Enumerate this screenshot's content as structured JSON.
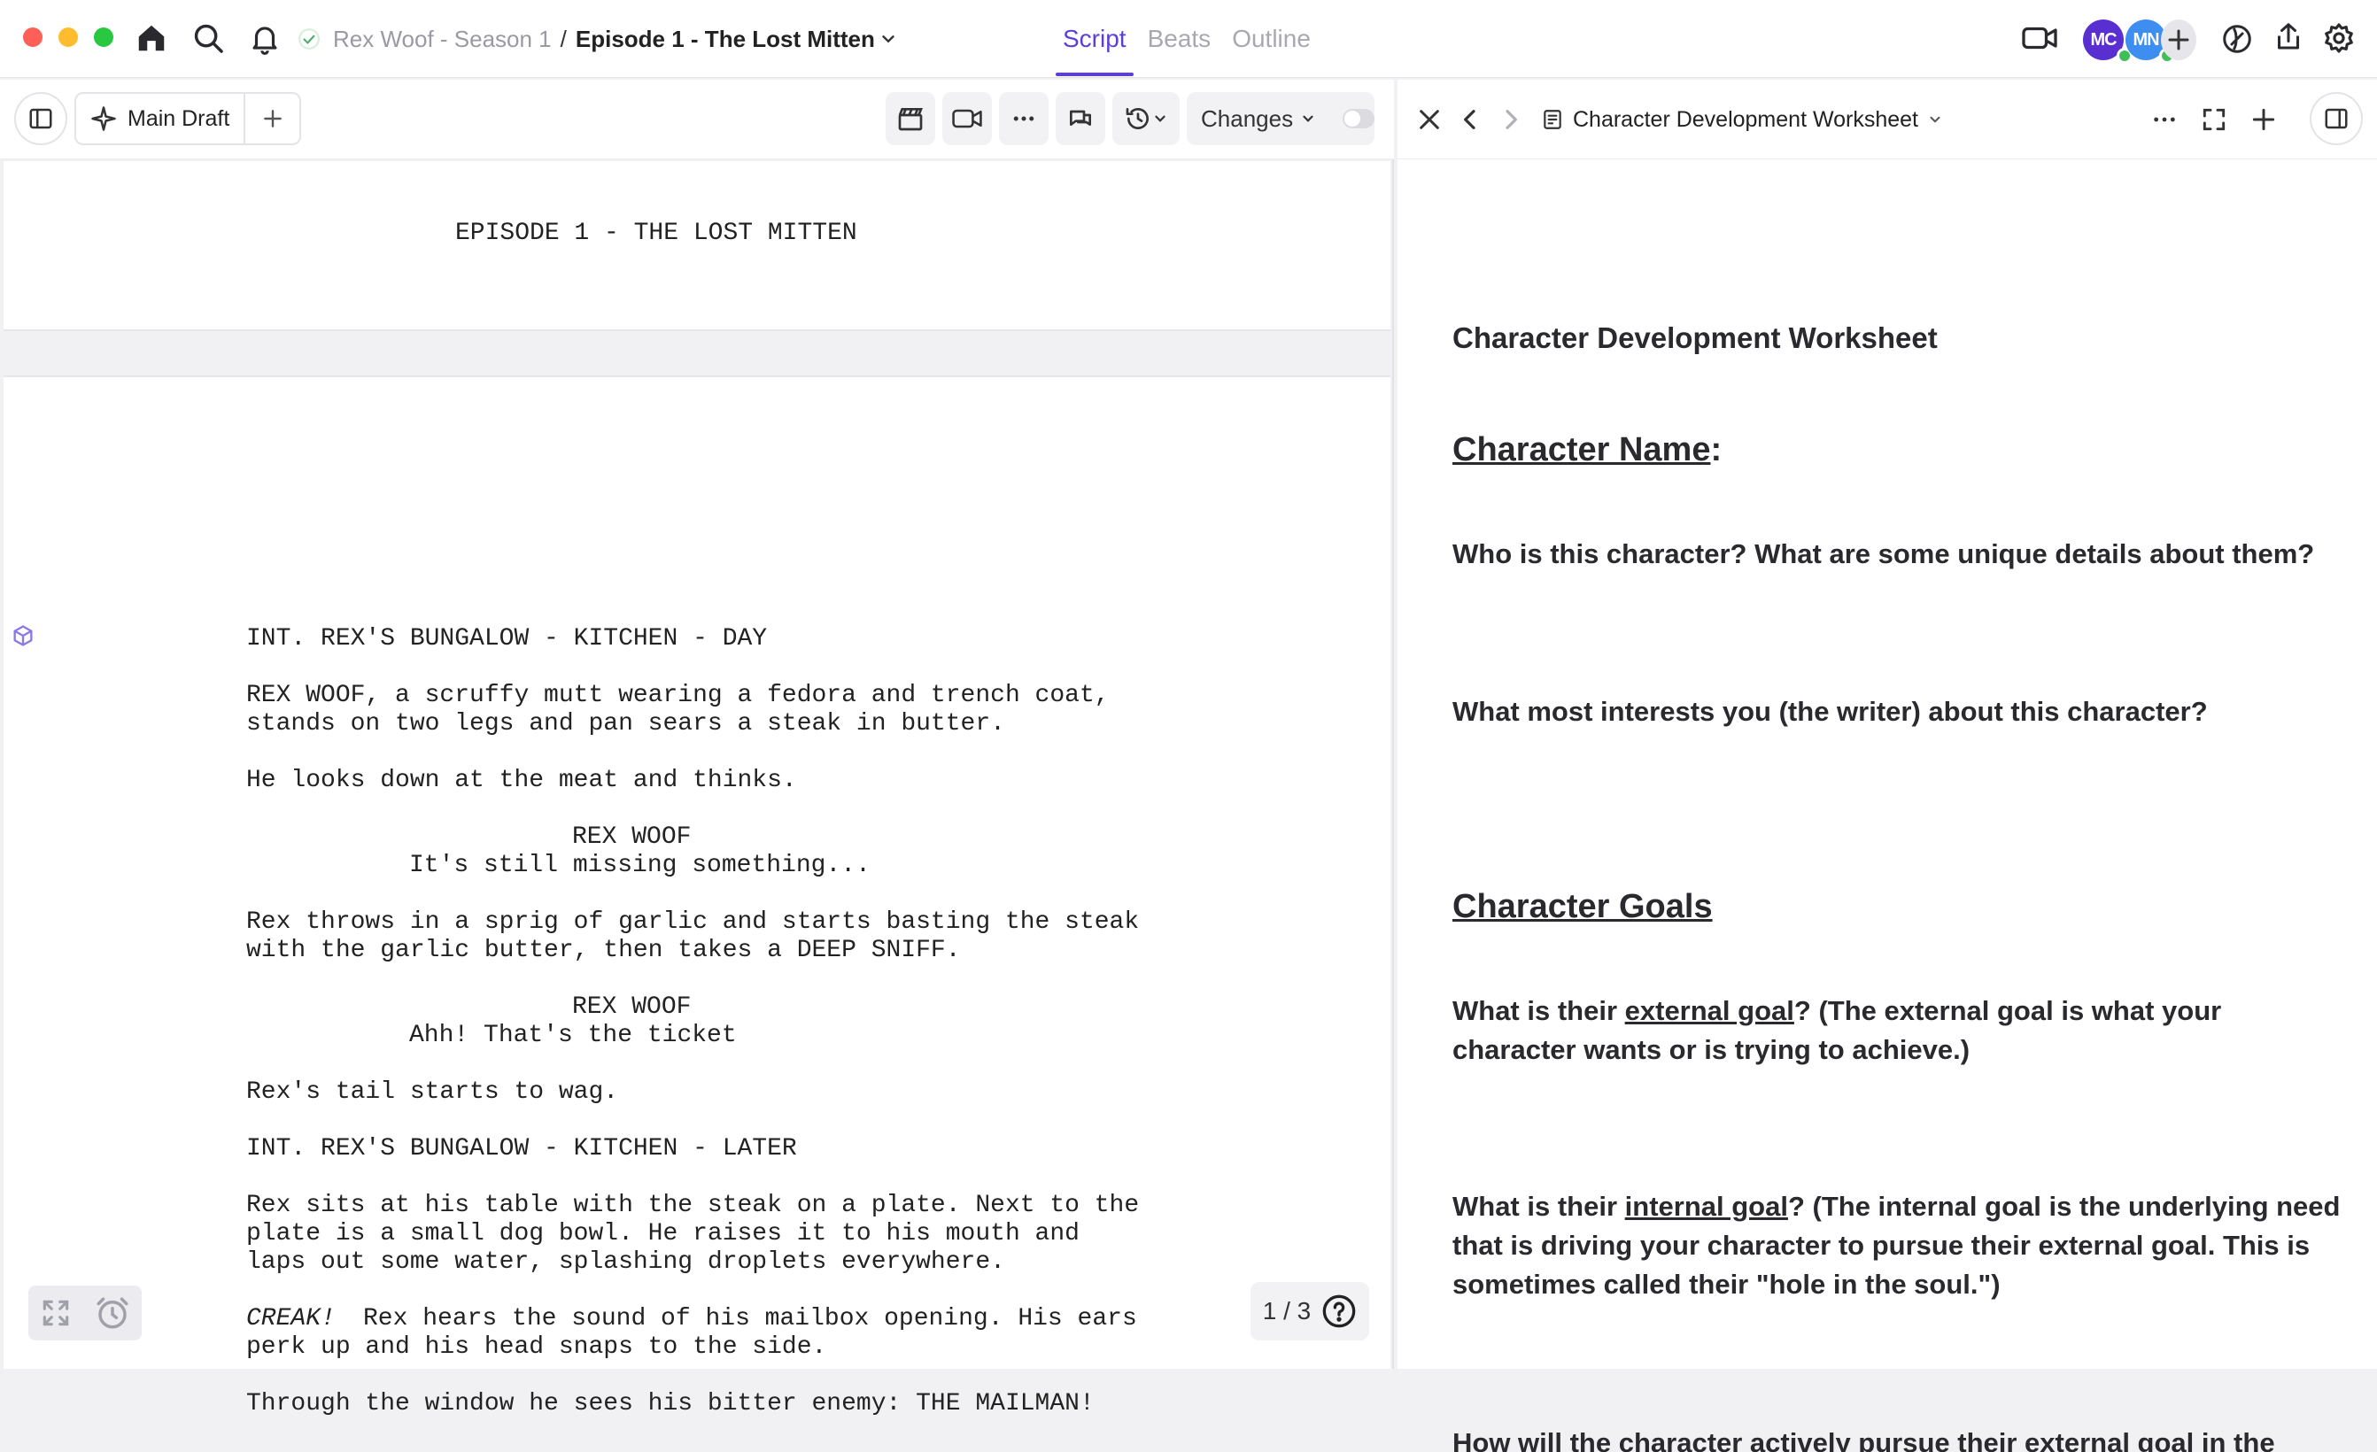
{
  "window": {
    "traffic_colors": [
      "#fe5f57",
      "#febc2e",
      "#28c840"
    ]
  },
  "header": {
    "project": "Rex Woof - Season 1",
    "separator": "/",
    "episode": "Episode 1 - The Lost Mitten",
    "tabs": [
      {
        "label": "Script",
        "active": true
      },
      {
        "label": "Beats",
        "active": false
      },
      {
        "label": "Outline",
        "active": false
      }
    ],
    "collaborators": [
      {
        "initials": "MC",
        "color": "#5a2fd1",
        "online": true
      },
      {
        "initials": "MN",
        "color": "#3d8ef0",
        "online": true
      }
    ]
  },
  "editor": {
    "draft_label": "Main Draft",
    "changes_label": "Changes",
    "changes_toggle_on": false,
    "page_indicator": "1 / 3",
    "title_page": "EPISODE 1 - THE LOST MITTEN",
    "lines": [
      {
        "type": "scene",
        "text": "INT. REX'S BUNGALOW - KITCHEN - DAY"
      },
      {
        "type": "action",
        "text": "REX WOOF, a scruffy mutt wearing a fedora and trench coat,"
      },
      {
        "type": "action",
        "text": "stands on two legs and pan sears a steak in butter."
      },
      {
        "type": "action",
        "text": "He looks down at the meat and thinks."
      },
      {
        "type": "character",
        "text": "REX WOOF"
      },
      {
        "type": "dialogue",
        "text": "It's still missing something..."
      },
      {
        "type": "action",
        "text": "Rex throws in a sprig of garlic and starts basting the steak"
      },
      {
        "type": "action",
        "text": "with the garlic butter, then takes a DEEP SNIFF."
      },
      {
        "type": "character",
        "text": "REX WOOF"
      },
      {
        "type": "dialogue",
        "text": "Ahh! That's the ticket"
      },
      {
        "type": "action",
        "text": "Rex's tail starts to wag."
      },
      {
        "type": "scene",
        "text": "INT. REX'S BUNGALOW - KITCHEN - LATER"
      },
      {
        "type": "action",
        "text": "Rex sits at his table with the steak on a plate. Next to the"
      },
      {
        "type": "action",
        "text": "plate is a small dog bowl. He raises it to his mouth and"
      },
      {
        "type": "action",
        "text": "laps out some water, splashing droplets everywhere."
      },
      {
        "type": "action",
        "text": "Rex hears the sound of his mailbox opening. His ears"
      },
      {
        "type": "action",
        "text": "perk up and his head snaps to the side."
      },
      {
        "type": "action",
        "text": "Through the window he sees his bitter enemy: THE MAILMAN!"
      }
    ],
    "creak": "CREAK!"
  },
  "panel": {
    "doc_title": "Character Development Worksheet",
    "content": {
      "title": "Character Development Worksheet",
      "name_heading": "Character Name",
      "name_colon": ":",
      "q1": "Who is this character? What are some unique details about them?",
      "q2": "What most interests you (the writer) about this character?",
      "goals_heading": "Character Goals",
      "q3_pre": "What is their ",
      "q3_link": "external goal",
      "q3_post": "? (The external goal is what your character wants or is trying to achieve.)",
      "q4_pre": "What is their ",
      "q4_link": "internal goal",
      "q4_post": "? (The internal goal is the underlying need that is driving your character to pursue their external goal. This is sometimes called their \"hole in the soul.\")",
      "q5": "How will the character actively pursue their external goal in the"
    }
  }
}
